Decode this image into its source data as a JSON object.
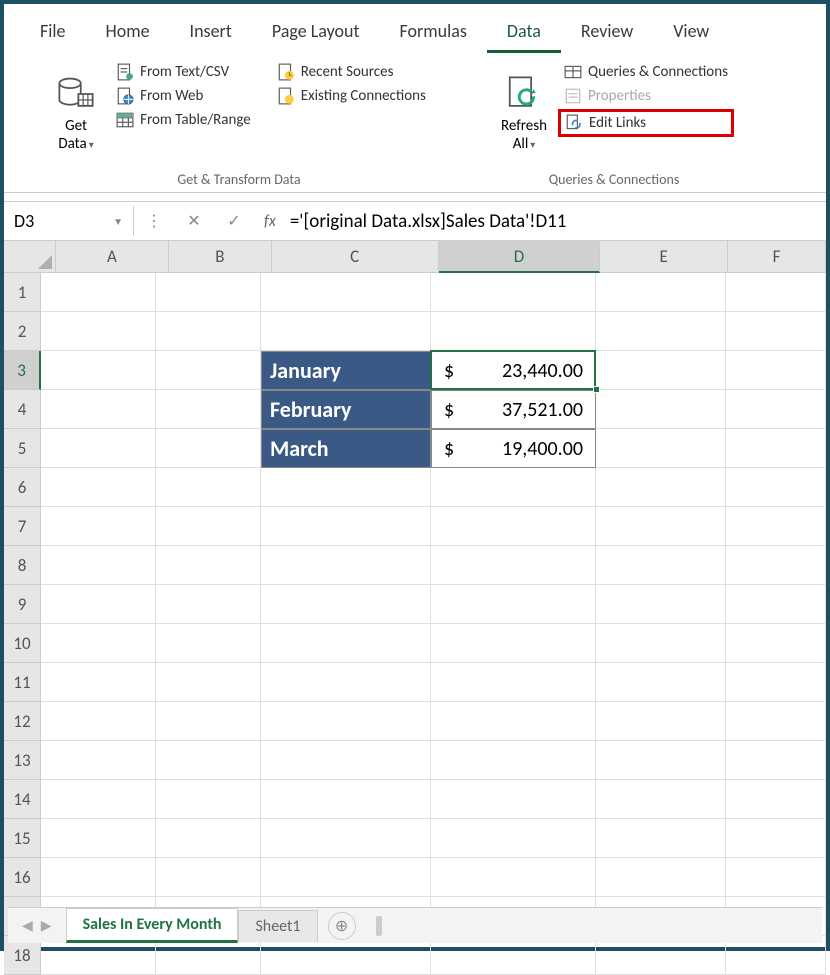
{
  "tabs": [
    "File",
    "Home",
    "Insert",
    "Page Layout",
    "Formulas",
    "Data",
    "Review",
    "View"
  ],
  "active_tab": "Data",
  "ribbon": {
    "get_data": "Get\nData",
    "from_text": "From Text/CSV",
    "from_web": "From Web",
    "from_table": "From Table/Range",
    "recent": "Recent Sources",
    "existing": "Existing Connections",
    "group1_label": "Get & Transform Data",
    "refresh": "Refresh\nAll",
    "queries_conn": "Queries & Connections",
    "properties": "Properties",
    "edit_links": "Edit Links",
    "group2_label": "Queries & Connections"
  },
  "name_box": "D3",
  "formula": "='[original Data.xlsx]Sales Data'!D11",
  "columns": [
    "A",
    "B",
    "C",
    "D",
    "E",
    "F"
  ],
  "active_col": "D",
  "active_row": 3,
  "row_count": 18,
  "months": [
    {
      "row": 3,
      "name": "January",
      "cur": "$",
      "val": "23,440.00"
    },
    {
      "row": 4,
      "name": "February",
      "cur": "$",
      "val": "37,521.00"
    },
    {
      "row": 5,
      "name": "March",
      "cur": "$",
      "val": "19,400.00"
    }
  ],
  "sheets": {
    "active": "Sales In Every Month",
    "other": "Sheet1"
  }
}
